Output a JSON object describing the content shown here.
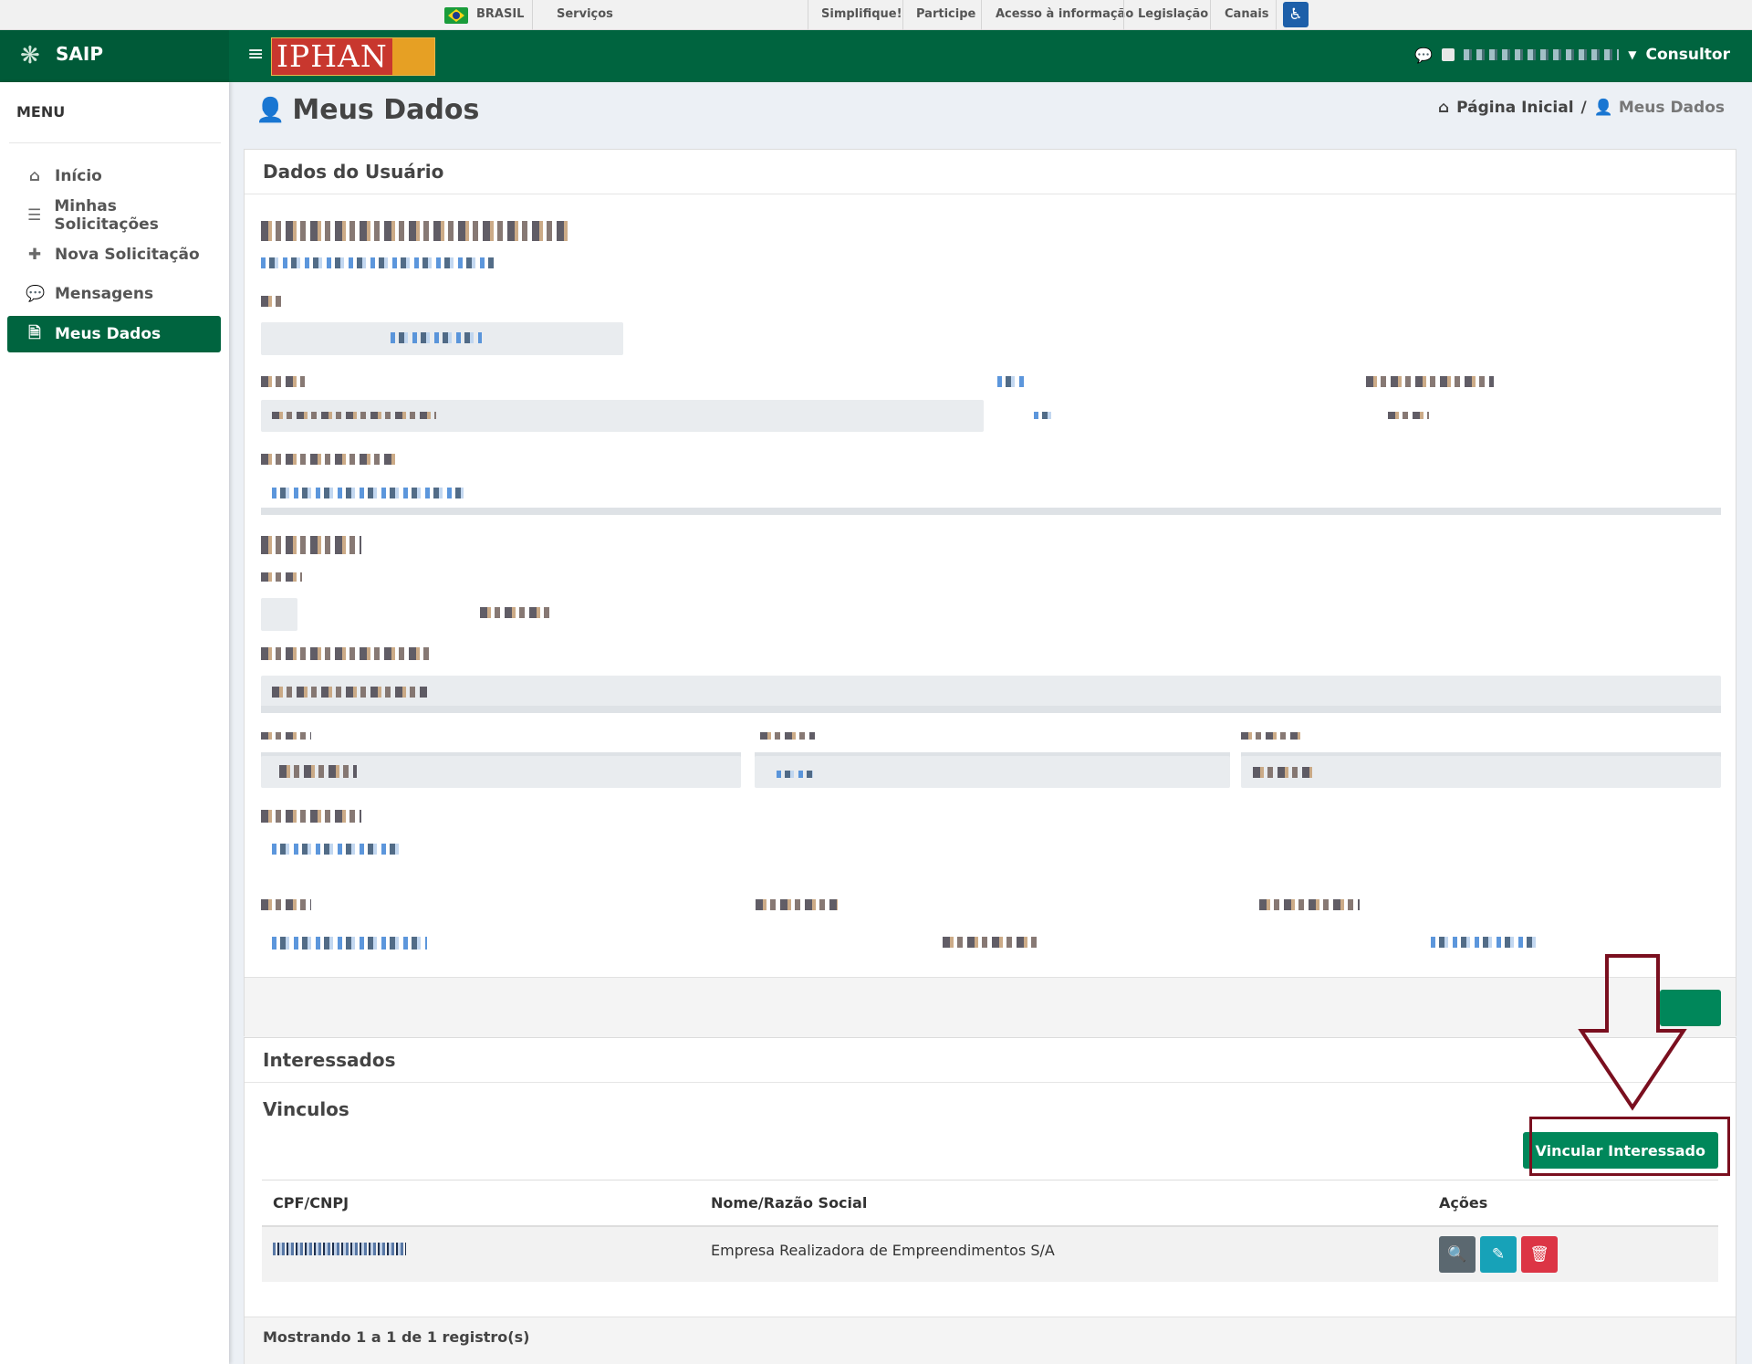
{
  "govbar": {
    "brasil": "BRASIL",
    "servicos": "Serviços",
    "links": [
      "Simplifique!",
      "Participe",
      "Acesso à informação",
      "Legislação",
      "Canais"
    ]
  },
  "header": {
    "brand": "SAIP",
    "logo_text": "IPHAN",
    "role": "Consultor"
  },
  "sidebar": {
    "title": "MENU",
    "items": [
      {
        "label": "Início",
        "icon": "home-icon",
        "glyph": "⌂"
      },
      {
        "label": "Minhas Solicitações",
        "icon": "list-icon",
        "glyph": "☰"
      },
      {
        "label": "Nova Solicitação",
        "icon": "plus-icon",
        "glyph": "✚"
      },
      {
        "label": "Mensagens",
        "icon": "chat-icon",
        "glyph": "💬"
      },
      {
        "label": "Meus Dados",
        "icon": "file-icon",
        "glyph": "🗎"
      }
    ]
  },
  "page": {
    "title": "Meus Dados",
    "breadcrumb": {
      "home": "Página Inicial",
      "current": "Meus Dados"
    }
  },
  "dados_panel": {
    "title": "Dados do Usuário"
  },
  "interessados_panel": {
    "title": "Interessados",
    "subtitle": "Vinculos",
    "add_button": "Vincular Interessado",
    "columns": [
      "CPF/CNPJ",
      "Nome/Razão Social",
      "Ações"
    ],
    "rows": [
      {
        "name": "Empresa Realizadora de Empreendimentos S/A"
      }
    ],
    "footer": "Mostrando 1 a 1 de 1 registro(s)"
  },
  "colors": {
    "primary": "#00643f",
    "button": "#00875a",
    "highlight": "#7a0f1f"
  }
}
